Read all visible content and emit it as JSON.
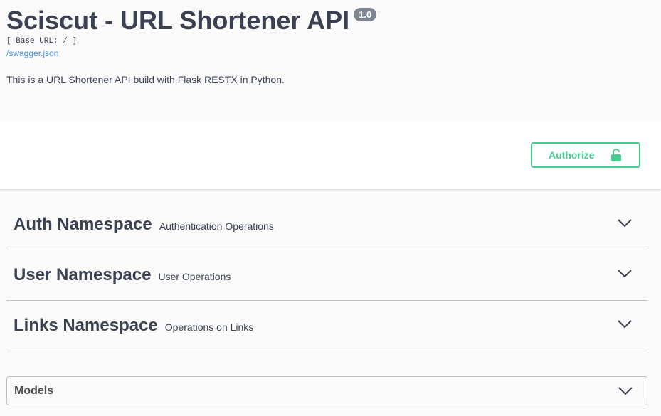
{
  "info": {
    "title": "Sciscut - URL Shortener API",
    "version": "1.0",
    "base_url": "[ Base URL: / ]",
    "spec_link": "/swagger.json",
    "description": "This is a URL Shortener API build with Flask RESTX in Python."
  },
  "auth": {
    "authorize_label": "Authorize"
  },
  "tags": [
    {
      "name": "Auth Namespace",
      "description": "Authentication Operations"
    },
    {
      "name": "User Namespace",
      "description": "User Operations"
    },
    {
      "name": "Links Namespace",
      "description": "Operations on Links"
    }
  ],
  "models": {
    "label": "Models"
  },
  "colors": {
    "accent_green": "#49cc90",
    "link_blue": "#4990e2",
    "text": "#3b4151",
    "version_badge": "#7d8492"
  },
  "icons": {
    "authorize": "unlocked-padlock-icon",
    "expand": "chevron-down-icon"
  }
}
